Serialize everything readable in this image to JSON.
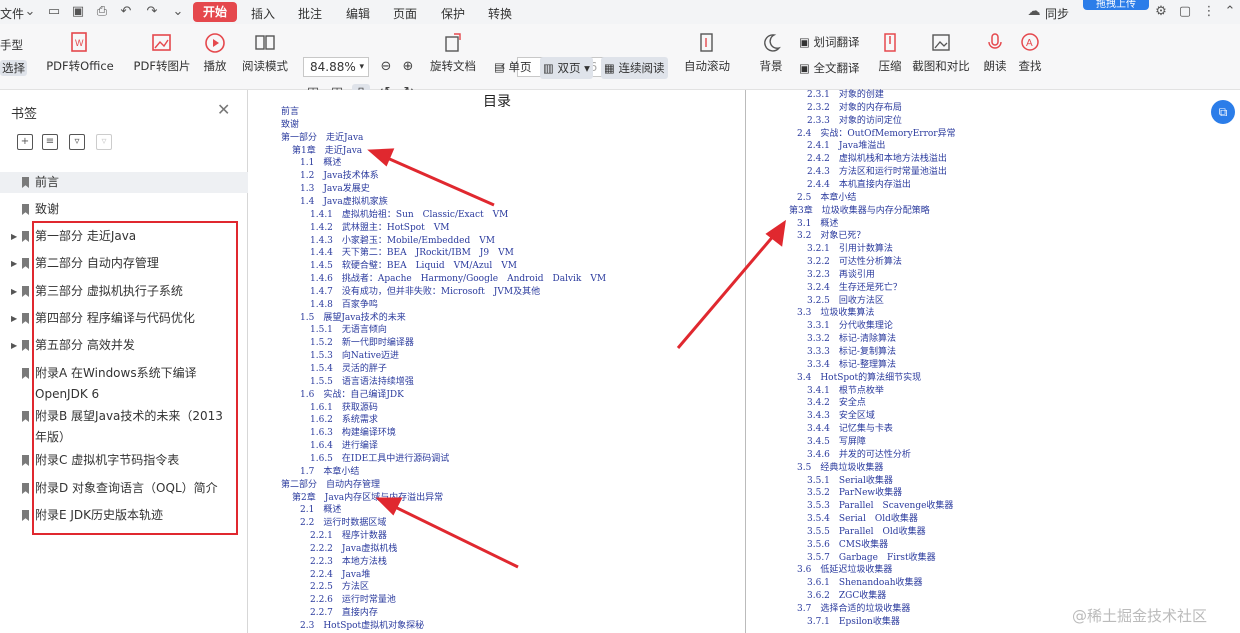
{
  "menubar": {
    "file": "文件",
    "tabs": [
      "开始",
      "插入",
      "批注",
      "编辑",
      "页面",
      "保护",
      "转换"
    ],
    "active_tab": "开始",
    "upload": "拖拽上传",
    "user_cut": "同步"
  },
  "toolbar": {
    "hand_mode": "手型",
    "select_mode": "选择",
    "pdf_to_office": "PDF转Office",
    "pdf_to_image": "PDF转图片",
    "play": "播放",
    "read_mode": "阅读模式",
    "zoom": "84.88%",
    "page_current": "3",
    "page_total": "/716",
    "rotate": "旋转文档",
    "single": "单页",
    "double": "双页",
    "continuous": "连续阅读",
    "auto_scroll": "自动滚动",
    "background": "背景",
    "word_translate": "划词翻译",
    "full_translate": "全文翻译",
    "compress": "压缩",
    "screenshot_compare": "截图和对比",
    "read_aloud": "朗读",
    "search": "查找"
  },
  "sidebar": {
    "title": "书签",
    "items": [
      {
        "label": "前言",
        "expandable": false
      },
      {
        "label": "致谢",
        "expandable": false
      },
      {
        "label": "第一部分 走近Java",
        "expandable": true
      },
      {
        "label": "第二部分 自动内存管理",
        "expandable": true
      },
      {
        "label": "第三部分 虚拟机执行子系统",
        "expandable": true
      },
      {
        "label": "第四部分 程序编译与代码优化",
        "expandable": true
      },
      {
        "label": "第五部分 高效并发",
        "expandable": true
      },
      {
        "label": "附录A 在Windows系统下编译OpenJDK 6",
        "expandable": false
      },
      {
        "label": "附录B 展望Java技术的未来（2013年版）",
        "expandable": false
      },
      {
        "label": "附录C 虚拟机字节码指令表",
        "expandable": false
      },
      {
        "label": "附录D 对象查询语言（OQL）简介",
        "expandable": false
      },
      {
        "label": "附录E JDK历史版本轨迹",
        "expandable": false
      }
    ]
  },
  "doc": {
    "title": "目录",
    "left_column": [
      "前言",
      "致谢",
      "第一部分　走近Java",
      "第1章　走近Java",
      "1.1　概述",
      "1.2　Java技术体系",
      "1.3　Java发展史",
      "1.4　Java虚拟机家族",
      "1.4.1　虚拟机始祖：Sun　Classic/Exact　VM",
      "1.4.2　武林盟主：HotSpot　VM",
      "1.4.3　小家碧玉：Mobile/Embedded　VM",
      "1.4.4　天下第二：BEA　JRockit/IBM　J9　VM",
      "1.4.5　软硬合璧：BEA　Liquid　VM/Azul　VM",
      "1.4.6　挑战者：Apache　Harmony/Google　Android　Dalvik　VM",
      "1.4.7　没有成功，但并非失败：Microsoft　JVM及其他",
      "1.4.8　百家争鸣",
      "1.5　展望Java技术的未来",
      "1.5.1　无语言倾向",
      "1.5.2　新一代即时编译器",
      "1.5.3　向Native迈进",
      "1.5.4　灵活的胖子",
      "1.5.5　语言语法持续增强",
      "1.6　实战：自己编译JDK",
      "1.6.1　获取源码",
      "1.6.2　系统需求",
      "1.6.3　构建编译环境",
      "1.6.4　进行编译",
      "1.6.5　在IDE工具中进行源码调试",
      "1.7　本章小结",
      "第二部分　自动内存管理",
      "第2章　Java内存区域与内存溢出异常",
      "2.1　概述",
      "2.2　运行时数据区域",
      "2.2.1　程序计数器",
      "2.2.2　Java虚拟机栈",
      "2.2.3　本地方法栈",
      "2.2.4　Java堆",
      "2.2.5　方法区",
      "2.2.6　运行时常量池",
      "2.2.7　直接内存",
      "2.3　HotSpot虚拟机对象探秘"
    ],
    "right_column": [
      "2.3.1　对象的创建",
      "2.3.2　对象的内存布局",
      "2.3.3　对象的访问定位",
      "2.4　实战：OutOfMemoryError异常",
      "2.4.1　Java堆溢出",
      "2.4.2　虚拟机栈和本地方法栈溢出",
      "2.4.3　方法区和运行时常量池溢出",
      "2.4.4　本机直接内存溢出",
      "2.5　本章小结",
      "第3章　垃圾收集器与内存分配策略",
      "3.1　概述",
      "3.2　对象已死？",
      "3.2.1　引用计数算法",
      "3.2.2　可达性分析算法",
      "3.2.3　再谈引用",
      "3.2.4　生存还是死亡？",
      "3.2.5　回收方法区",
      "3.3　垃圾收集算法",
      "3.3.1　分代收集理论",
      "3.3.2　标记-清除算法",
      "3.3.3　标记-复制算法",
      "3.3.4　标记-整理算法",
      "3.4　HotSpot的算法细节实现",
      "3.4.1　根节点枚举",
      "3.4.2　安全点",
      "3.4.3　安全区域",
      "3.4.4　记忆集与卡表",
      "3.4.5　写屏障",
      "3.4.6　并发的可达性分析",
      "3.5　经典垃圾收集器",
      "3.5.1　Serial收集器",
      "3.5.2　ParNew收集器",
      "3.5.3　Parallel　Scavenge收集器",
      "3.5.4　Serial　Old收集器",
      "3.5.5　Parallel　Old收集器",
      "3.5.6　CMS收集器",
      "3.5.7　Garbage　First收集器",
      "3.6　低延迟垃圾收集器",
      "3.6.1　Shenandoah收集器",
      "3.6.2　ZGC收集器",
      "3.7　选择合适的垃圾收集器",
      "3.7.1　Epsilon收集器"
    ]
  },
  "watermark": "@稀土掘金技术社区",
  "colors": {
    "accent_red": "#e5484d",
    "annotation_red": "#e0282f",
    "link_blue": "#2b3b9e",
    "brand_blue": "#2b7de9"
  }
}
